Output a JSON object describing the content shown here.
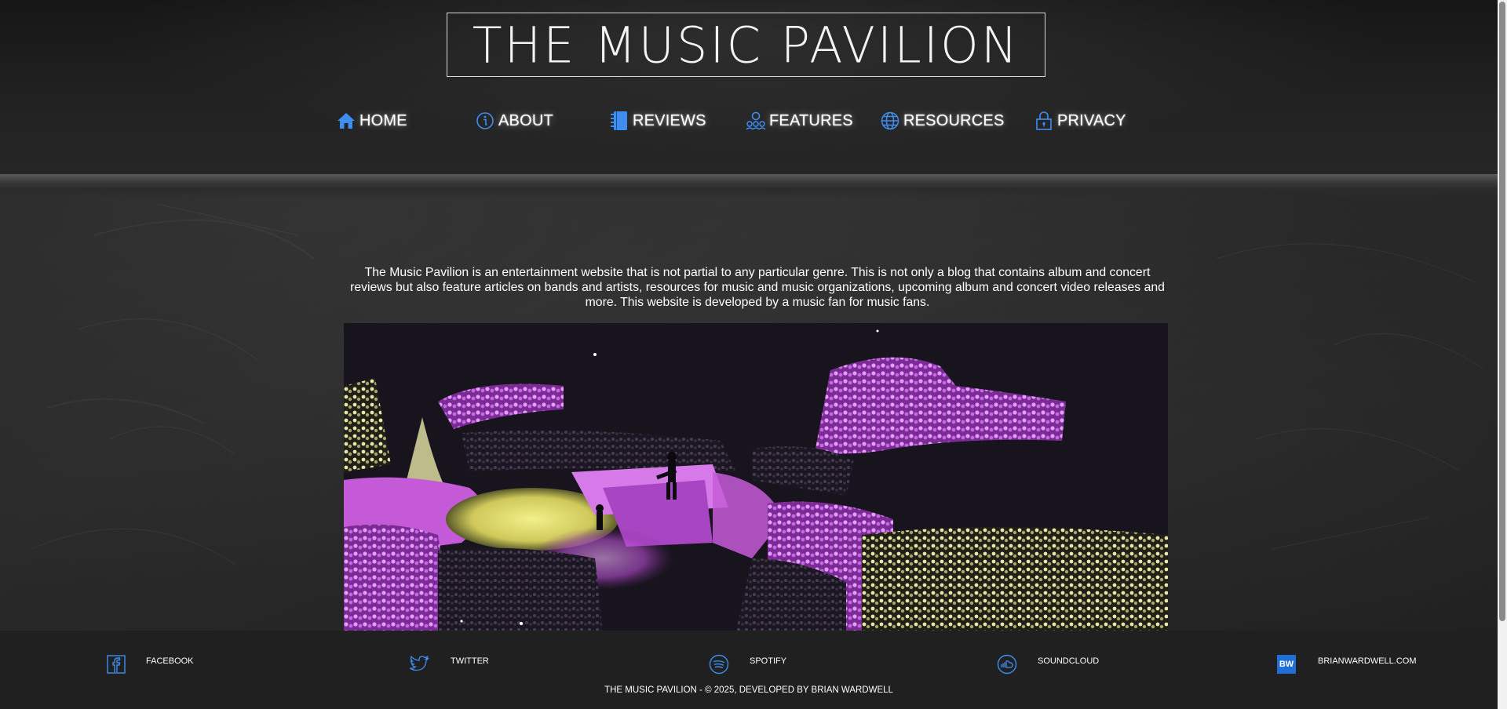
{
  "site": {
    "logo_text": "THE MUSIC PAVILION"
  },
  "nav": {
    "items": [
      {
        "label": "HOME",
        "icon": "home-icon"
      },
      {
        "label": "ABOUT",
        "icon": "info-icon"
      },
      {
        "label": "REVIEWS",
        "icon": "notebook-icon"
      },
      {
        "label": "FEATURES",
        "icon": "people-icon"
      },
      {
        "label": "RESOURCES",
        "icon": "globe-icon"
      },
      {
        "label": "PRIVACY",
        "icon": "lock-icon"
      }
    ]
  },
  "main": {
    "intro_text": "The Music Pavilion is an entertainment website that is not partial to any particular genre. This is not only a blog that contains album and concert reviews but also feature articles on bands and artists, resources for music and music organizations, upcoming album and concert video releases and more. This website is developed by a music fan for music fans."
  },
  "footer": {
    "social": [
      {
        "label": "FACEBOOK",
        "icon": "facebook-icon"
      },
      {
        "label": "TWITTER",
        "icon": "twitter-icon"
      },
      {
        "label": "SPOTIFY",
        "icon": "spotify-icon"
      },
      {
        "label": "SOUNDCLOUD",
        "icon": "soundcloud-icon"
      },
      {
        "label": "BRIANWARDWELL.COM",
        "icon": "bw-logo-icon",
        "icon_text": "BW"
      }
    ],
    "copyright": "THE MUSIC PAVILION - © 2025, DEVELOPED BY BRIAN WARDWELL"
  },
  "colors": {
    "accent": "#3d8ef0",
    "footer_bg": "#202020",
    "hero_magenta": "#c55ad8",
    "hero_yellow": "#e6e27a"
  }
}
